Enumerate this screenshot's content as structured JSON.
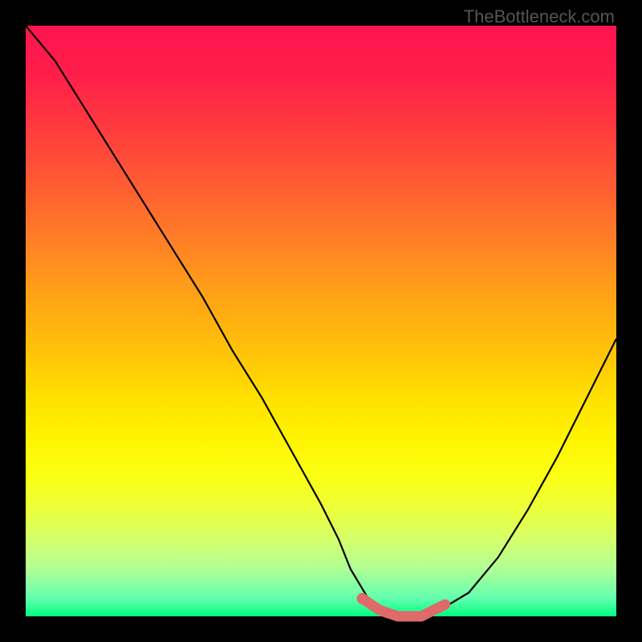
{
  "watermark": "TheBottleneck.com",
  "chart_data": {
    "type": "line",
    "title": "",
    "xlabel": "",
    "ylabel": "",
    "xlim": [
      0,
      100
    ],
    "ylim": [
      0,
      100
    ],
    "series": [
      {
        "name": "bottleneck-curve",
        "x": [
          0,
          5,
          10,
          15,
          20,
          25,
          30,
          35,
          40,
          45,
          50,
          53,
          55,
          58,
          60,
          63,
          65,
          67,
          70,
          75,
          80,
          85,
          90,
          95,
          100
        ],
        "values": [
          100,
          94,
          86,
          78,
          70,
          62,
          54,
          45,
          37,
          28,
          19,
          13,
          8,
          3,
          1,
          0,
          0,
          0,
          1,
          4,
          10,
          18,
          27,
          37,
          47
        ]
      },
      {
        "name": "highlight-segment",
        "x": [
          57,
          60,
          63,
          65,
          67,
          69,
          71
        ],
        "values": [
          3,
          1,
          0,
          0,
          0,
          1,
          2
        ]
      }
    ],
    "colors": {
      "curve": "#000000",
      "highlight": "#e06666",
      "gradient_top": "#ff1450",
      "gradient_mid": "#ffe000",
      "gradient_bottom": "#00ff80",
      "background": "#000000"
    }
  }
}
